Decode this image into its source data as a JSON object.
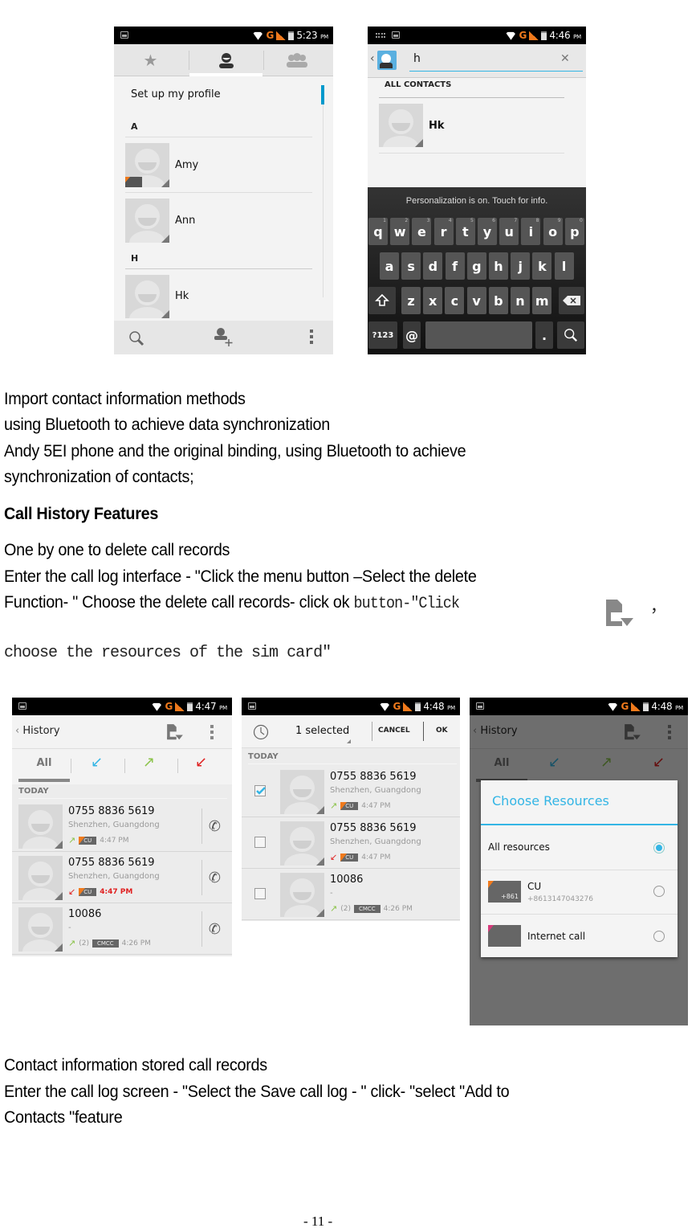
{
  "screens": {
    "contacts": {
      "status_time": "5:23",
      "status_ampm": "PM",
      "tabs": [
        {
          "icon": "star-icon",
          "label": "Favorites"
        },
        {
          "icon": "person-icon",
          "label": "Contacts",
          "active": true
        },
        {
          "icon": "group-icon",
          "label": "Groups"
        }
      ],
      "profile_label": "Set up my profile",
      "sections": [
        {
          "letter": "A",
          "contacts": [
            "Amy",
            "Ann"
          ]
        },
        {
          "letter": "H",
          "contacts": [
            "Hk"
          ]
        }
      ],
      "bottom_actions": [
        "search-icon",
        "add-contact-icon",
        "overflow-menu-icon"
      ]
    },
    "search": {
      "status_time": "4:46",
      "status_ampm": "PM",
      "query": "h",
      "section_header": "ALL CONTACTS",
      "results": [
        "Hk"
      ],
      "keyboard_hint": "Personalization is on. Touch for info.",
      "keys_row1": [
        "q",
        "w",
        "e",
        "r",
        "t",
        "y",
        "u",
        "i",
        "o",
        "p"
      ],
      "keys_row1_nums": [
        "1",
        "2",
        "3",
        "4",
        "5",
        "6",
        "7",
        "8",
        "9",
        "0"
      ],
      "keys_row2": [
        "a",
        "s",
        "d",
        "f",
        "g",
        "h",
        "j",
        "k",
        "l"
      ],
      "keys_row3": [
        "z",
        "x",
        "c",
        "v",
        "b",
        "n",
        "m"
      ],
      "key_symbols": "?123",
      "key_at": "@",
      "key_period": "."
    },
    "history": {
      "status_time": "4:47",
      "status_ampm": "PM",
      "title": "History",
      "filter_tabs": [
        "All",
        "incoming",
        "outgoing",
        "missed"
      ],
      "section": "TODAY",
      "entries": [
        {
          "number": "0755 8836 5619",
          "location": "Shenzhen, Guangdong",
          "type": "outgoing",
          "sim": "CU",
          "time": "4:47 PM",
          "count": ""
        },
        {
          "number": "0755 8836 5619",
          "location": "Shenzhen, Guangdong",
          "type": "missed",
          "sim": "CU",
          "time": "4:47 PM",
          "count": ""
        },
        {
          "number": "10086",
          "location": "-",
          "type": "outgoing",
          "sim": "CMCC",
          "time": "4:26 PM",
          "count": "(2)"
        }
      ]
    },
    "select": {
      "status_time": "4:48",
      "status_ampm": "PM",
      "selected_label": "1 selected",
      "cancel_label": "CANCEL",
      "ok_label": "OK",
      "section": "TODAY",
      "entries": [
        {
          "number": "0755 8836 5619",
          "location": "Shenzhen, Guangdong",
          "type": "outgoing",
          "sim": "CU",
          "time": "4:47 PM",
          "count": "",
          "checked": true
        },
        {
          "number": "0755 8836 5619",
          "location": "Shenzhen, Guangdong",
          "type": "missed",
          "sim": "CU",
          "time": "4:47 PM",
          "count": "",
          "checked": false
        },
        {
          "number": "10086",
          "location": "-",
          "type": "outgoing",
          "sim": "CMCC",
          "time": "4:26 PM",
          "count": "(2)",
          "checked": false
        }
      ]
    },
    "resources": {
      "status_time": "4:48",
      "status_ampm": "PM",
      "title": "History",
      "filter_tabs": [
        "All",
        "incoming",
        "outgoing",
        "missed"
      ],
      "dialog_title": "Choose Resources",
      "options": [
        {
          "label": "All resources",
          "sub": "",
          "selected": true
        },
        {
          "label": "CU",
          "sub": "+8613147043276",
          "badge": "+861",
          "selected": false
        },
        {
          "label": "Internet call",
          "sub": "",
          "selected": false
        }
      ]
    }
  },
  "doc": {
    "p1": "Import contact information methods",
    "p2": "using Bluetooth to achieve data synchronization",
    "p3": "Andy 5EI phone and the original binding, using Bluetooth to achieve",
    "p4": "synchronization of contacts;",
    "heading": "Call History Features",
    "p5": "One by one to delete call records",
    "p6": "Enter the call log interface - \"Click the menu button –Select the delete",
    "p7a": "Function- \" Choose the delete call records- click ok",
    "p7b": "button-\"Click",
    "p7c": "，",
    "p8": "choose the resources of the sim card\"",
    "p9": "Contact information stored call records",
    "p10": "Enter the call log screen - \"Select the Save call log - \" click- \"select \"Add to",
    "p11": "Contacts \"feature",
    "page_number": "- 11 -"
  },
  "colors": {
    "accent_blue": "#33b5e5",
    "orange": "#f07a1c",
    "incoming_blue": "#33b5e5",
    "outgoing_green": "#8bc34a",
    "missed_red": "#e02020"
  }
}
